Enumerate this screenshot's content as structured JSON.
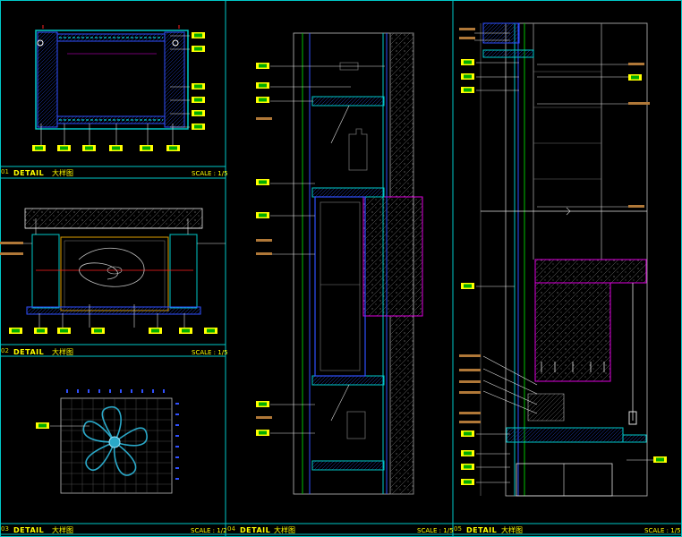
{
  "colors": {
    "frame": "#00c8c8",
    "title_text": "#ffff00",
    "tag": "#ffff00",
    "tag_inner": "#00aa00",
    "note": "#b07838",
    "leader": "#e0e0e0",
    "magenta": "#e000e0",
    "blue": "#3050ff",
    "green": "#00c000",
    "red": "#ff2020",
    "hatch": "#808080"
  },
  "panels": [
    {
      "id": "p1",
      "number": "01",
      "title": "DETAIL",
      "subtitle": "大样图",
      "scale": "SCALE : 1/5"
    },
    {
      "id": "p2",
      "number": "02",
      "title": "DETAIL",
      "subtitle": "大样图",
      "scale": "SCALE : 1/5"
    },
    {
      "id": "p3",
      "number": "03",
      "title": "DETAIL",
      "subtitle": "大样图",
      "scale": "SCALE : 1/2"
    },
    {
      "id": "p4",
      "number": "04",
      "title": "DETAIL",
      "subtitle": "大样图",
      "scale": "SCALE : 1/5"
    },
    {
      "id": "p5",
      "number": "05",
      "title": "DETAIL",
      "subtitle": "大样图",
      "scale": "SCALE : 1/5"
    }
  ]
}
